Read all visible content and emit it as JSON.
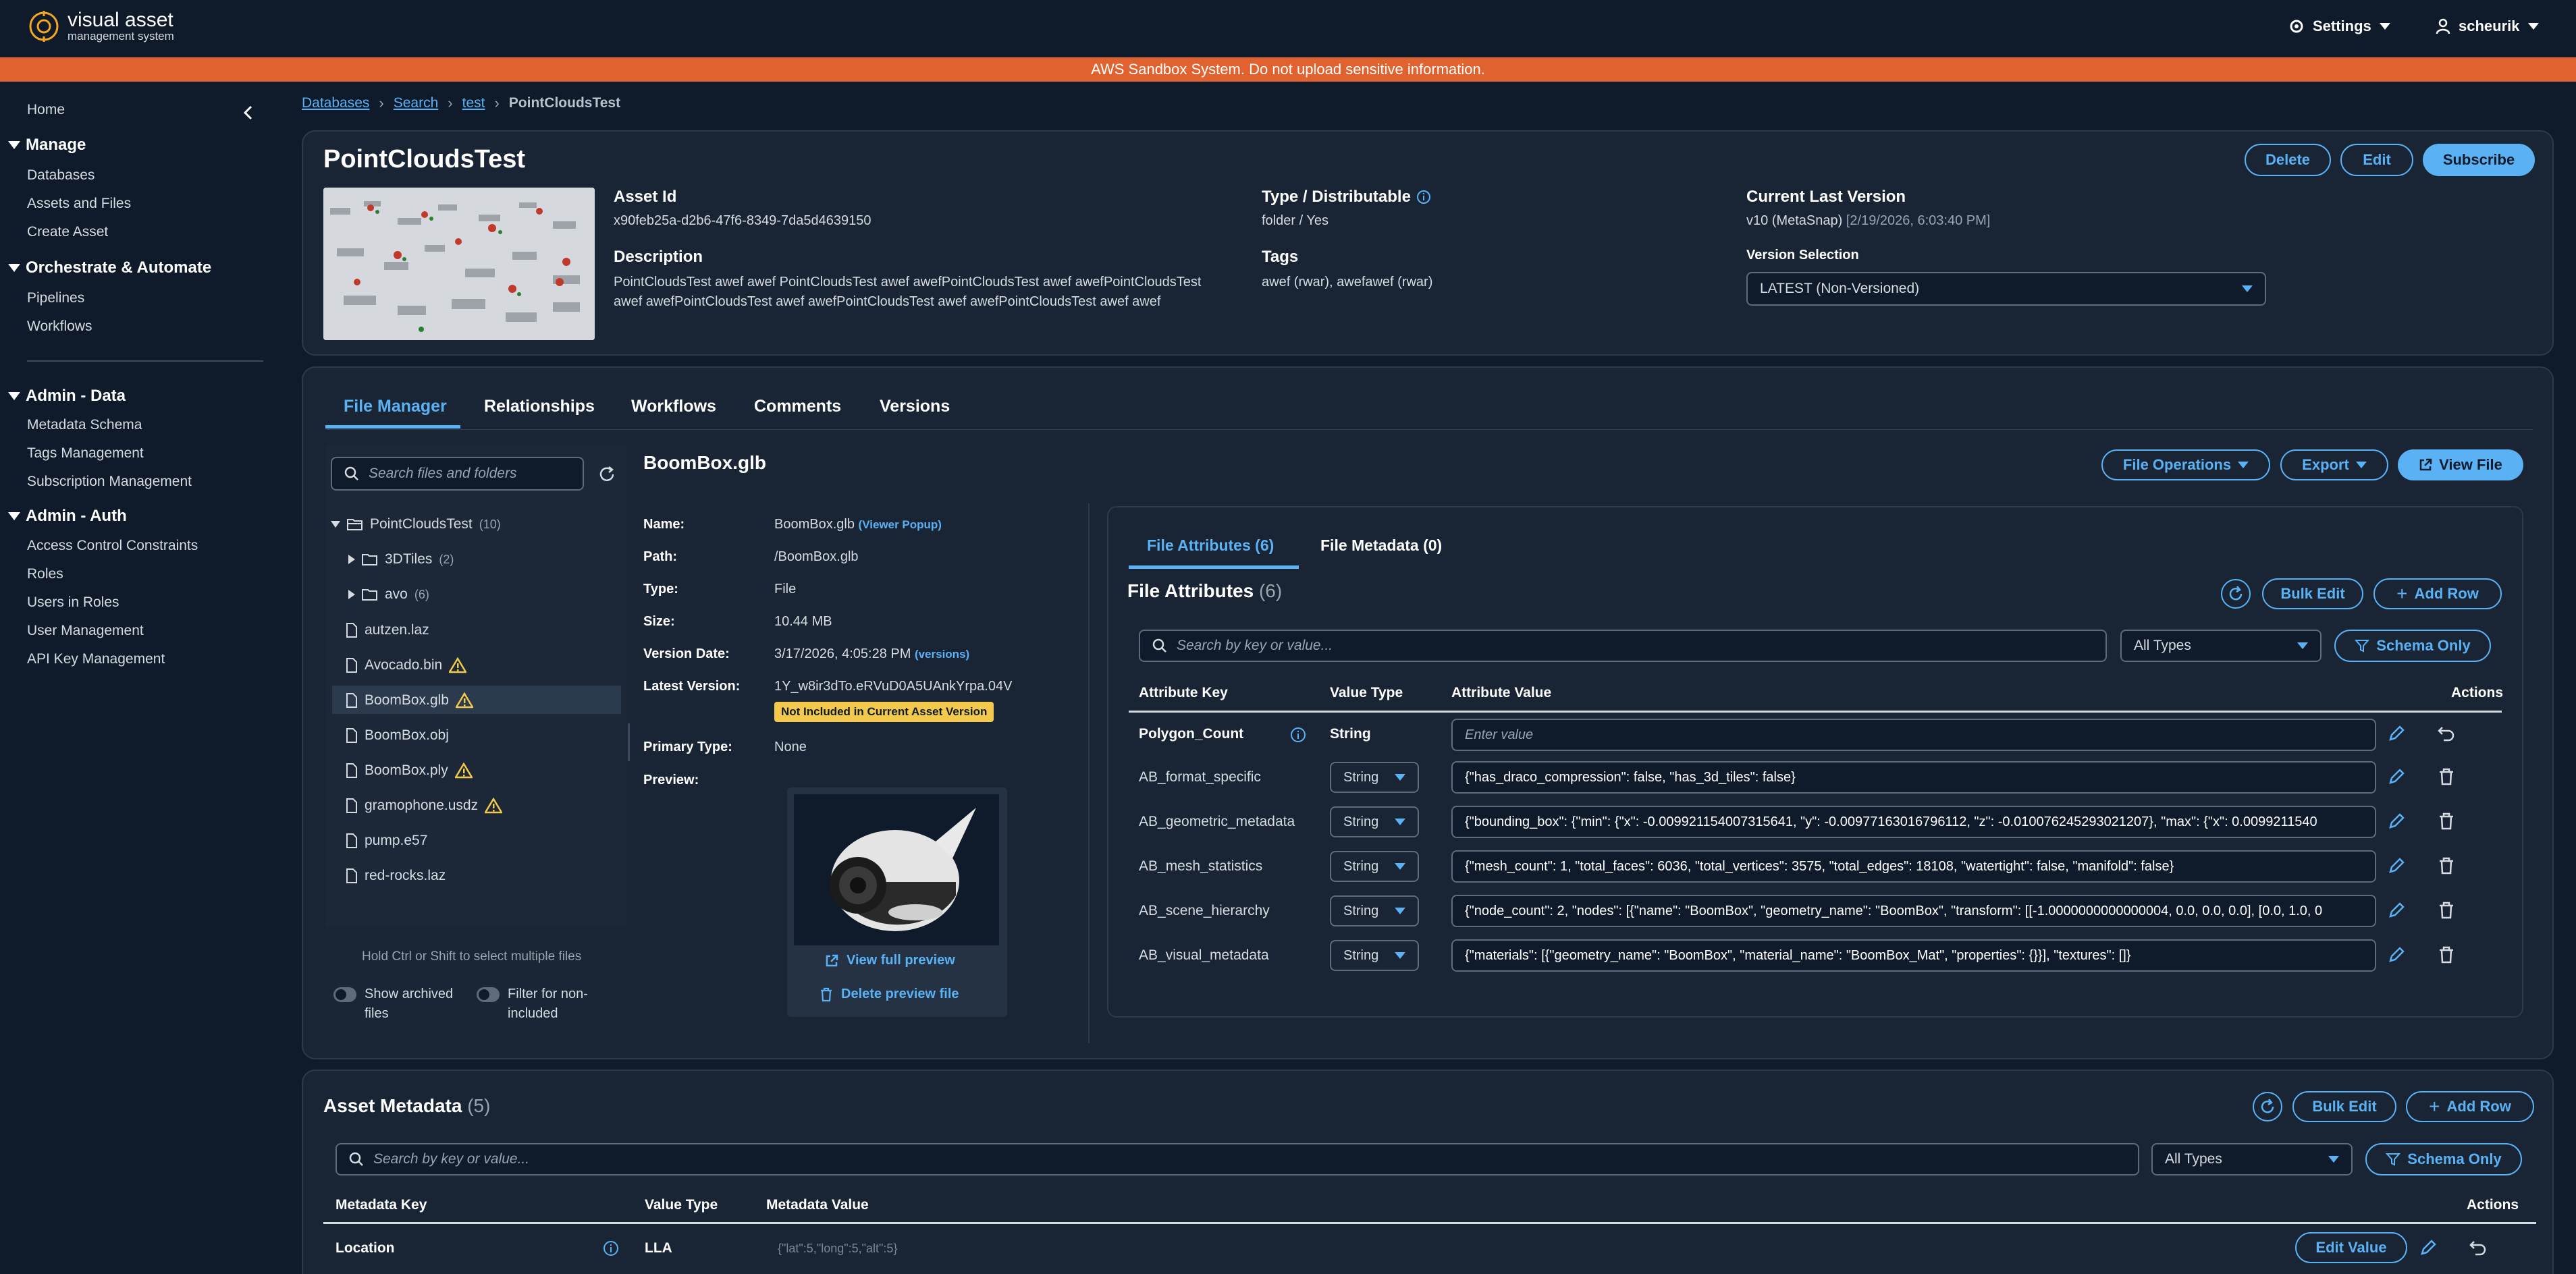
{
  "app": {
    "logo_line1": "visual asset",
    "logo_line2": "management system",
    "settings_label": "Settings",
    "user_label": "scheurik",
    "banner": "AWS Sandbox System. Do not upload sensitive information."
  },
  "sidebar": {
    "home": "Home",
    "sections": [
      {
        "title": "Manage",
        "items": [
          "Databases",
          "Assets and Files",
          "Create Asset"
        ]
      },
      {
        "title": "Orchestrate & Automate",
        "items": [
          "Pipelines",
          "Workflows"
        ]
      },
      {
        "title": "Admin - Data",
        "items": [
          "Metadata Schema",
          "Tags Management",
          "Subscription Management"
        ]
      },
      {
        "title": "Admin - Auth",
        "items": [
          "Access Control Constraints",
          "Roles",
          "Users in Roles",
          "User Management",
          "API Key Management"
        ]
      }
    ]
  },
  "breadcrumb": {
    "items": [
      "Databases",
      "Search",
      "test"
    ],
    "current": "PointCloudsTest"
  },
  "asset": {
    "title": "PointCloudsTest",
    "delete_label": "Delete",
    "edit_label": "Edit",
    "subscribe_label": "Subscribe",
    "asset_id_label": "Asset Id",
    "asset_id": "x90feb25a-d2b6-47f6-8349-7da5d4639150",
    "description_label": "Description",
    "description_line1": "PointCloudsTest awef awef PointCloudsTest awef awefPointCloudsTest awef awefPointCloudsTest",
    "description_line2": "awef awefPointCloudsTest awef awefPointCloudsTest awef awefPointCloudsTest awef awef",
    "type_label": "Type / Distributable",
    "type_value": "folder / Yes",
    "tags_label": "Tags",
    "tags_value": "awef (rwar), awefawef (rwar)",
    "version_label": "Current Last Version",
    "version_value": "v10 (MetaSnap)",
    "version_date": "[2/19/2026, 6:03:40 PM]",
    "version_selection_label": "Version Selection",
    "version_selection_value": "LATEST (Non-Versioned)"
  },
  "tabs": [
    "File Manager",
    "Relationships",
    "Workflows",
    "Comments",
    "Versions"
  ],
  "file_manager": {
    "search_placeholder": "Search files and folders",
    "root": {
      "name": "PointCloudsTest",
      "count": "(10)"
    },
    "folders": [
      {
        "name": "3DTiles",
        "count": "(2)"
      },
      {
        "name": "avo",
        "count": "(6)"
      }
    ],
    "files": [
      {
        "name": "autzen.laz",
        "warn": false
      },
      {
        "name": "Avocado.bin",
        "warn": true
      },
      {
        "name": "BoomBox.glb",
        "warn": true
      },
      {
        "name": "BoomBox.obj",
        "warn": false
      },
      {
        "name": "BoomBox.ply",
        "warn": true
      },
      {
        "name": "gramophone.usdz",
        "warn": true
      },
      {
        "name": "pump.e57",
        "warn": false
      },
      {
        "name": "red-rocks.laz",
        "warn": false
      }
    ],
    "hint": "Hold Ctrl or Shift to select multiple files",
    "show_archived_line1": "Show archived",
    "show_archived_line2": "files",
    "filter_line1": "Filter for non-",
    "filter_line2": "included"
  },
  "file_detail": {
    "title": "BoomBox.glb",
    "file_ops_label": "File Operations",
    "export_label": "Export",
    "view_file_label": "View File",
    "name_label": "Name:",
    "name_value": "BoomBox.glb",
    "viewer_popup": "(Viewer Popup)",
    "path_label": "Path:",
    "path_value": "/BoomBox.glb",
    "type_label": "Type:",
    "type_value": "File",
    "size_label": "Size:",
    "size_value": "10.44 MB",
    "version_date_label": "Version Date:",
    "version_date_value": "3/17/2026, 4:05:28 PM",
    "versions_link": "(versions)",
    "latest_version_label": "Latest Version:",
    "latest_version_value": "1Y_w8ir3dTo.eRVuD0A5UAnkYrpa.04V",
    "not_included_badge": "Not Included in Current Asset Version",
    "primary_type_label": "Primary Type:",
    "primary_type_value": "None",
    "preview_label": "Preview:",
    "view_full_preview": "View full preview",
    "delete_preview": "Delete preview file"
  },
  "attributes": {
    "tab_attrs": "File Attributes (6)",
    "tab_metadata": "File Metadata (0)",
    "title": "File Attributes",
    "count": "(6)",
    "bulk_edit": "Bulk Edit",
    "add_row": "Add Row",
    "search_placeholder": "Search by key or value...",
    "type_filter": "All Types",
    "schema_only": "Schema Only",
    "col_key": "Attribute Key",
    "col_type": "Value Type",
    "col_value": "Attribute Value",
    "col_actions": "Actions",
    "first_row": {
      "key": "Polygon_Count",
      "type": "String",
      "placeholder": "Enter value"
    },
    "rows": [
      {
        "key": "AB_format_specific",
        "type": "String",
        "value": "{\"has_draco_compression\": false, \"has_3d_tiles\": false}"
      },
      {
        "key": "AB_geometric_metadata",
        "type": "String",
        "value": "{\"bounding_box\": {\"min\": {\"x\": -0.009921154007315641, \"y\": -0.00977163016796112, \"z\": -0.010076245293021207}, \"max\": {\"x\": 0.0099211540"
      },
      {
        "key": "AB_mesh_statistics",
        "type": "String",
        "value": "{\"mesh_count\": 1, \"total_faces\": 6036, \"total_vertices\": 3575, \"total_edges\": 18108, \"watertight\": false, \"manifold\": false}"
      },
      {
        "key": "AB_scene_hierarchy",
        "type": "String",
        "value": "{\"node_count\": 2, \"nodes\": [{\"name\": \"BoomBox\", \"geometry_name\": \"BoomBox\", \"transform\": [[-1.0000000000000004, 0.0, 0.0, 0.0], [0.0, 1.0, 0"
      },
      {
        "key": "AB_visual_metadata",
        "type": "String",
        "value": "{\"materials\": [{\"geometry_name\": \"BoomBox\", \"material_name\": \"BoomBox_Mat\", \"properties\": {}}], \"textures\": []}"
      }
    ]
  },
  "asset_metadata": {
    "title": "Asset Metadata",
    "count": "(5)",
    "bulk_edit": "Bulk Edit",
    "add_row": "Add Row",
    "search_placeholder": "Search by key or value...",
    "type_filter": "All Types",
    "schema_only": "Schema Only",
    "col_key": "Metadata Key",
    "col_type": "Value Type",
    "col_value": "Metadata Value",
    "col_actions": "Actions",
    "row": {
      "key": "Location",
      "type": "LLA",
      "value": "{\"lat\":5,\"long\":5,\"alt\":5}",
      "edit_value": "Edit Value"
    }
  },
  "colors": {
    "accent": "#5ab2f5",
    "banner": "#e0622f",
    "bg": "#0f1b2a",
    "card": "#192534",
    "warning": "#f2c94c"
  }
}
